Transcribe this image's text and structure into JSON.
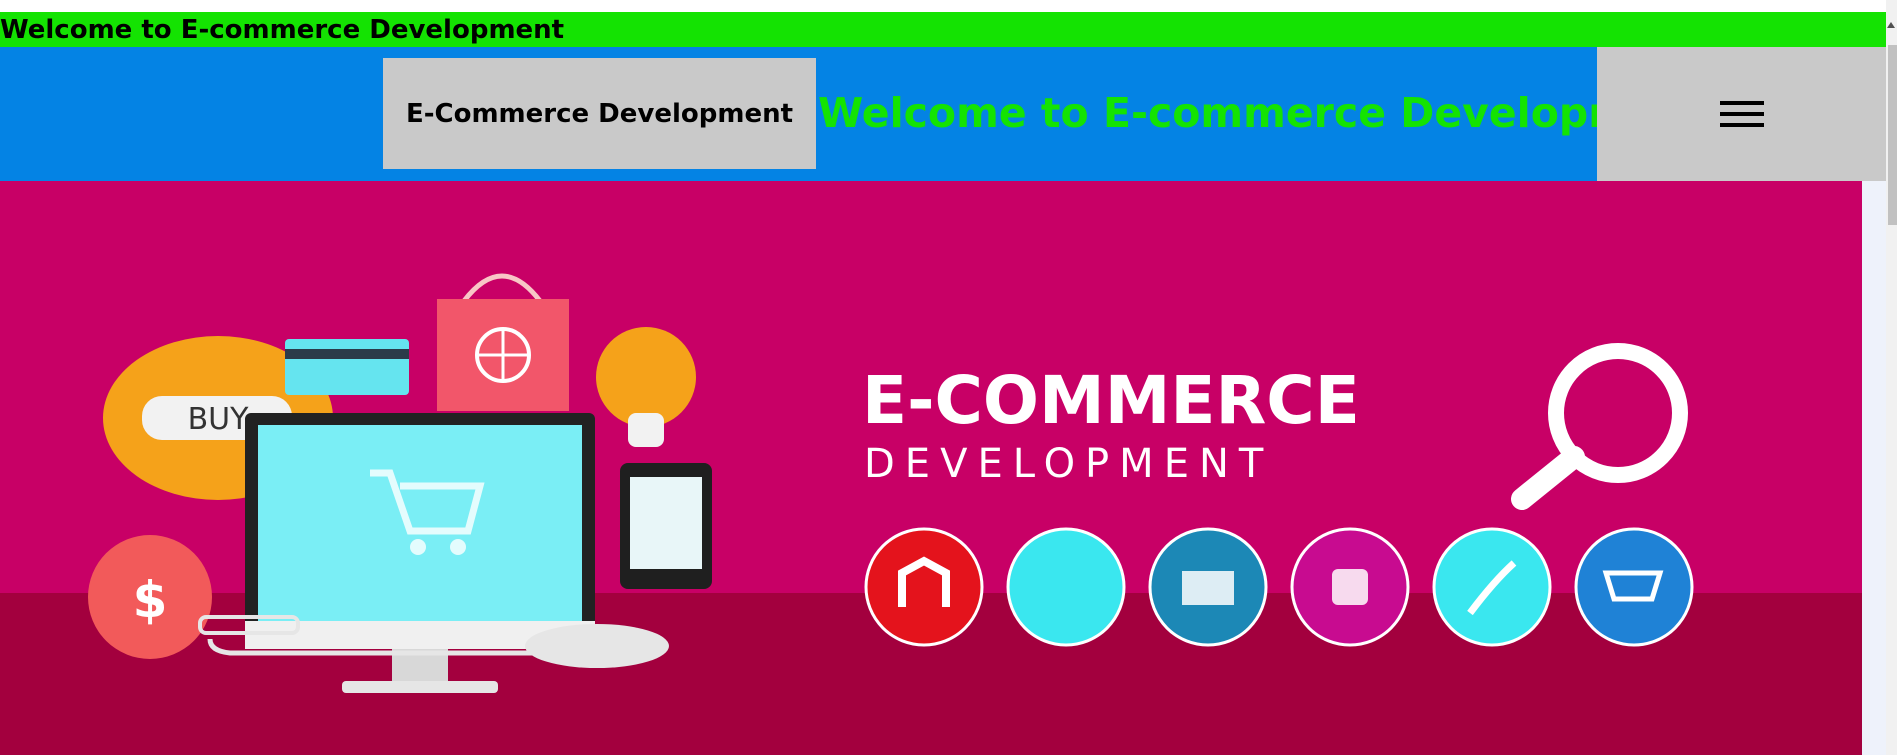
{
  "marquee": {
    "text": "Welcome to E-commerce Development"
  },
  "header": {
    "brand_label": "E-Commerce Development",
    "welcome_heading": "Welcome to E-commerce Development",
    "menu_icon": "hamburger-menu-icon",
    "colors": {
      "background": "#0483e4",
      "button_bg": "#c9c9c9",
      "heading": "#14e302"
    }
  },
  "hero": {
    "alt": "E-Commerce Development banner",
    "title_line1": "E-COMMERCE",
    "title_line2": "DEVELOPMENT",
    "buy_label": "BUY",
    "dollar_label": "$",
    "platform_icons": [
      "magento-icon",
      "cart-dots-icon",
      "screen-cart-icon",
      "bag-icon",
      "swift-icon",
      "shopping-cart-icon"
    ],
    "colors": {
      "background": "#c80066",
      "floor": "#a3003e"
    }
  },
  "colors": {
    "marquee_bg": "#14e302"
  }
}
